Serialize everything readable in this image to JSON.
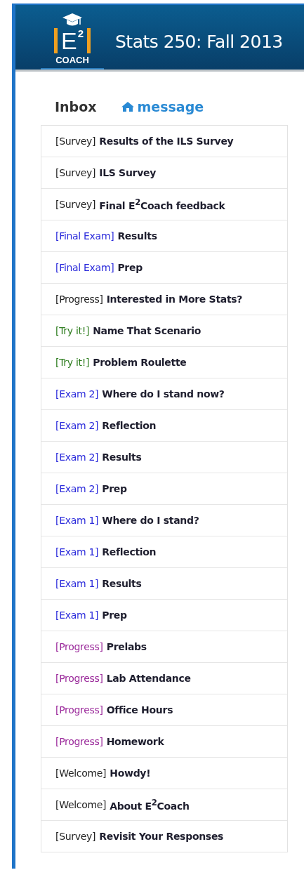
{
  "header": {
    "logo": {
      "letter": "E",
      "superscript": "2",
      "caption": "COACH"
    },
    "title": "Stats 250: Fall 2013"
  },
  "inbox": {
    "heading": "Inbox",
    "link": "message"
  },
  "messages": [
    {
      "tag": "[Survey]",
      "color": "#222222",
      "title": "Results of the ILS Survey"
    },
    {
      "tag": "[Survey]",
      "color": "#222222",
      "title": "ILS Survey"
    },
    {
      "tag": "[Survey]",
      "color": "#222222",
      "title": "Final E$^{2}$Coach feedback"
    },
    {
      "tag": "[Final Exam]",
      "color": "#2b2bdb",
      "title": "Results"
    },
    {
      "tag": "[Final Exam]",
      "color": "#2b2bdb",
      "title": "Prep"
    },
    {
      "tag": "[Progress]",
      "color": "#222222",
      "title": "Interested in More Stats?"
    },
    {
      "tag": "[Try it!]",
      "color": "#2e7d1f",
      "title": "Name That Scenario"
    },
    {
      "tag": "[Try it!]",
      "color": "#2e7d1f",
      "title": "Problem Roulette"
    },
    {
      "tag": "[Exam 2]",
      "color": "#2b2bdb",
      "title": "Where do I stand now?"
    },
    {
      "tag": "[Exam 2]",
      "color": "#2b2bdb",
      "title": "Reflection"
    },
    {
      "tag": "[Exam 2]",
      "color": "#2b2bdb",
      "title": "Results"
    },
    {
      "tag": "[Exam 2]",
      "color": "#2b2bdb",
      "title": "Prep"
    },
    {
      "tag": "[Exam 1]",
      "color": "#2b2bdb",
      "title": "Where do I stand?"
    },
    {
      "tag": "[Exam 1]",
      "color": "#2b2bdb",
      "title": "Reflection"
    },
    {
      "tag": "[Exam 1]",
      "color": "#2b2bdb",
      "title": "Results"
    },
    {
      "tag": "[Exam 1]",
      "color": "#2b2bdb",
      "title": "Prep"
    },
    {
      "tag": "[Progress]",
      "color": "#9b2a9b",
      "title": "Prelabs"
    },
    {
      "tag": "[Progress]",
      "color": "#9b2a9b",
      "title": "Lab Attendance"
    },
    {
      "tag": "[Progress]",
      "color": "#9b2a9b",
      "title": "Office Hours"
    },
    {
      "tag": "[Progress]",
      "color": "#9b2a9b",
      "title": "Homework"
    },
    {
      "tag": "[Welcome]",
      "color": "#222222",
      "title": "Howdy!"
    },
    {
      "tag": "[Welcome]",
      "color": "#222222",
      "title": "About E$^{2}$Coach"
    },
    {
      "tag": "[Survey]",
      "color": "#222222",
      "title": "Revisit Your Responses"
    }
  ]
}
